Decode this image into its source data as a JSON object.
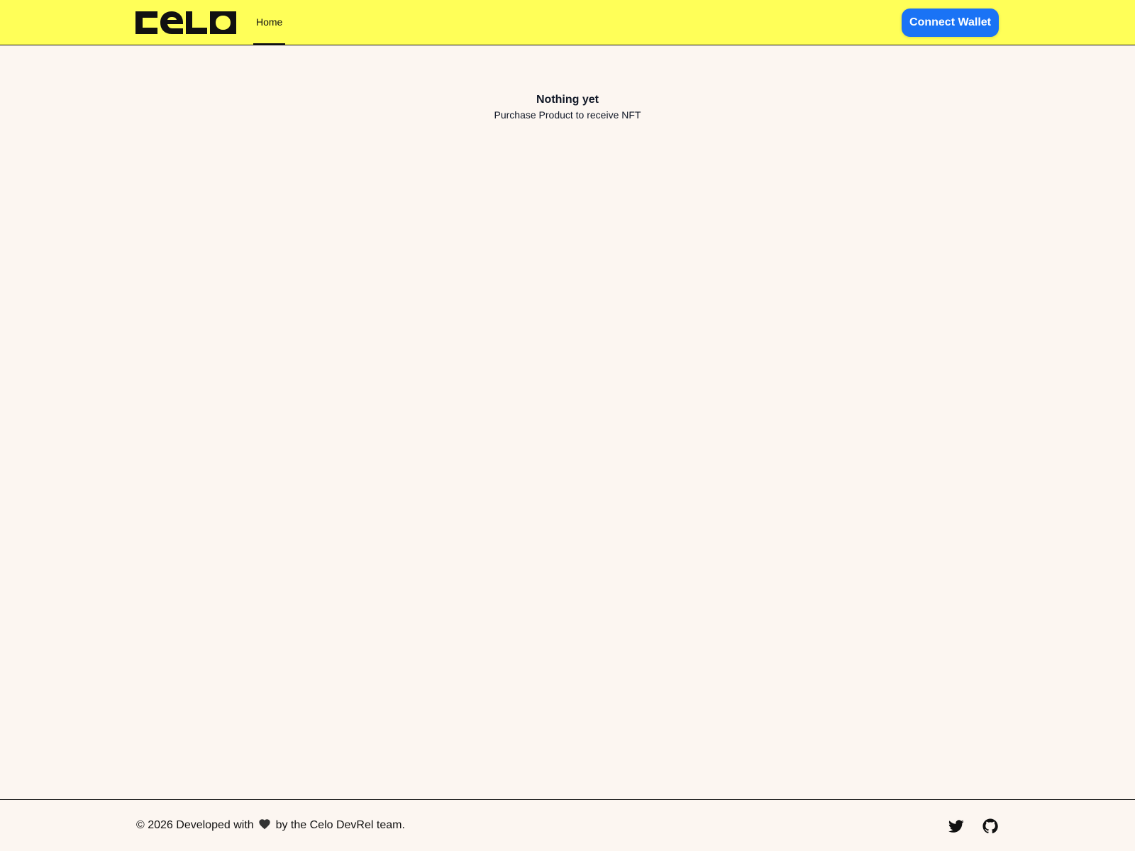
{
  "header": {
    "logo_text": "Celo",
    "nav": [
      {
        "label": "Home",
        "active": true
      }
    ],
    "connect_button_label": "Connect Wallet"
  },
  "main": {
    "empty_title": "Nothing yet",
    "empty_subtitle": "Purchase Product to receive NFT"
  },
  "footer": {
    "text_before_heart": "© 2026 Developed with",
    "text_after_heart": "by the Celo DevRel team.",
    "social_icons": [
      "twitter-icon",
      "github-icon"
    ]
  },
  "colors": {
    "header_bg": "#FFFF58",
    "page_bg": "#FCF6F1",
    "button_bg": "#1A73F5",
    "text": "#111111"
  }
}
